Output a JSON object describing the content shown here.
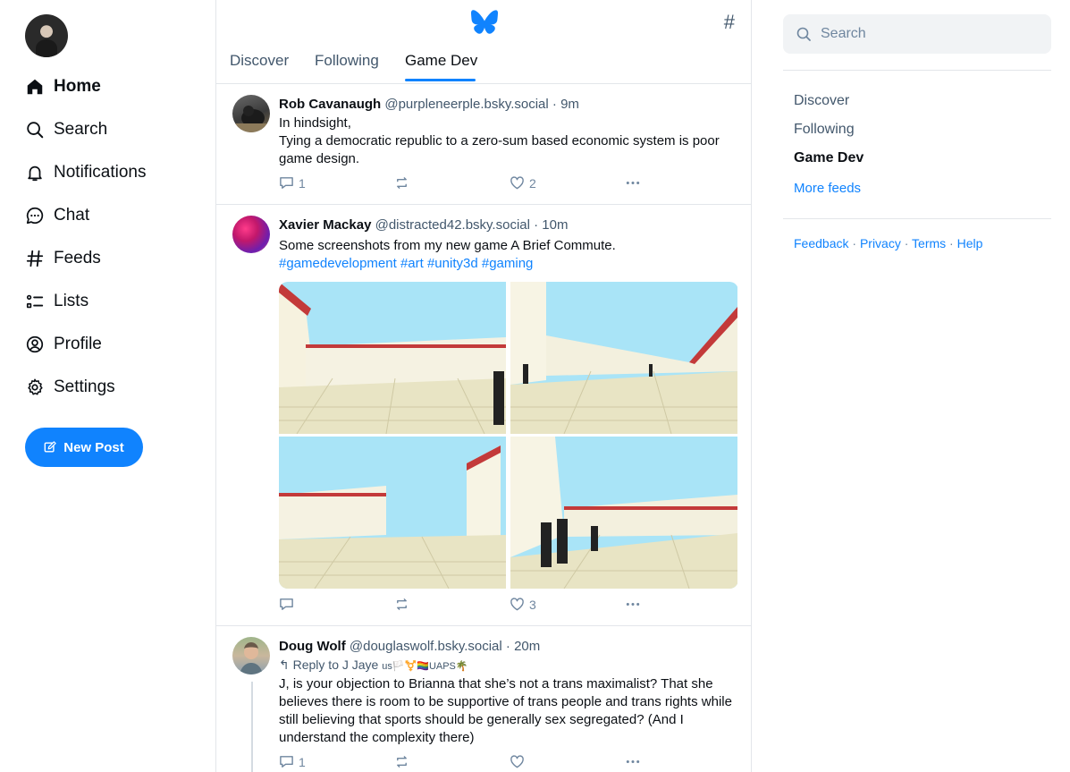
{
  "nav": {
    "items": [
      {
        "label": "Home",
        "icon": "home-icon"
      },
      {
        "label": "Search",
        "icon": "search-icon"
      },
      {
        "label": "Notifications",
        "icon": "bell-icon"
      },
      {
        "label": "Chat",
        "icon": "chat-icon"
      },
      {
        "label": "Feeds",
        "icon": "hash-icon"
      },
      {
        "label": "Lists",
        "icon": "list-icon"
      },
      {
        "label": "Profile",
        "icon": "profile-icon"
      },
      {
        "label": "Settings",
        "icon": "gear-icon"
      }
    ],
    "new_post_label": "New Post"
  },
  "header": {
    "tabs": [
      "Discover",
      "Following",
      "Game Dev"
    ],
    "active_tab": "Game Dev",
    "hash_glyph": "#"
  },
  "posts": [
    {
      "author": "Rob Cavanaugh",
      "handle": "@purpleneerple.bsky.social",
      "sep": "·",
      "time": "9m",
      "lines": [
        "In hindsight,",
        "Tying a democratic republic to a zero-sum based economic system is poor game design."
      ],
      "replies": "1",
      "reposts": "",
      "likes": "2"
    },
    {
      "author": "Xavier Mackay",
      "handle": "@distracted42.bsky.social",
      "sep": "·",
      "time": "10m",
      "text": "Some screenshots from my new game A Brief Commute.",
      "tags": [
        "#gamedevelopment",
        "#art",
        "#unity3d",
        "#gaming"
      ],
      "images": 4,
      "replies": "",
      "reposts": "",
      "likes": "3"
    },
    {
      "author": "Doug Wolf",
      "handle": "@douglaswolf.bsky.social",
      "sep": "·",
      "time": "20m",
      "reply_to_prefix": "Reply to",
      "reply_to": "J Jaye",
      "reply_to_suffix": "us🏳️⚧️🏳️‍🌈UAPS🌴",
      "text": "J, is your objection to Brianna that she’s not a trans maximalist?  That she believes there is room to be supportive of trans people and trans rights while still believing that sports should be generally sex segregated?   (And I understand the complexity there)",
      "replies": "1",
      "reposts": "",
      "likes": ""
    }
  ],
  "sidebar": {
    "search_placeholder": "Search",
    "feeds": [
      "Discover",
      "Following",
      "Game Dev"
    ],
    "active_feed": "Game Dev",
    "more_feeds": "More feeds",
    "footer": [
      "Feedback",
      "Privacy",
      "Terms",
      "Help"
    ],
    "footer_sep": " · "
  },
  "colors": {
    "accent": "#1083fe",
    "text_primary": "#0b0f14",
    "text_secondary": "#42576c",
    "border": "#e3e6ea"
  }
}
